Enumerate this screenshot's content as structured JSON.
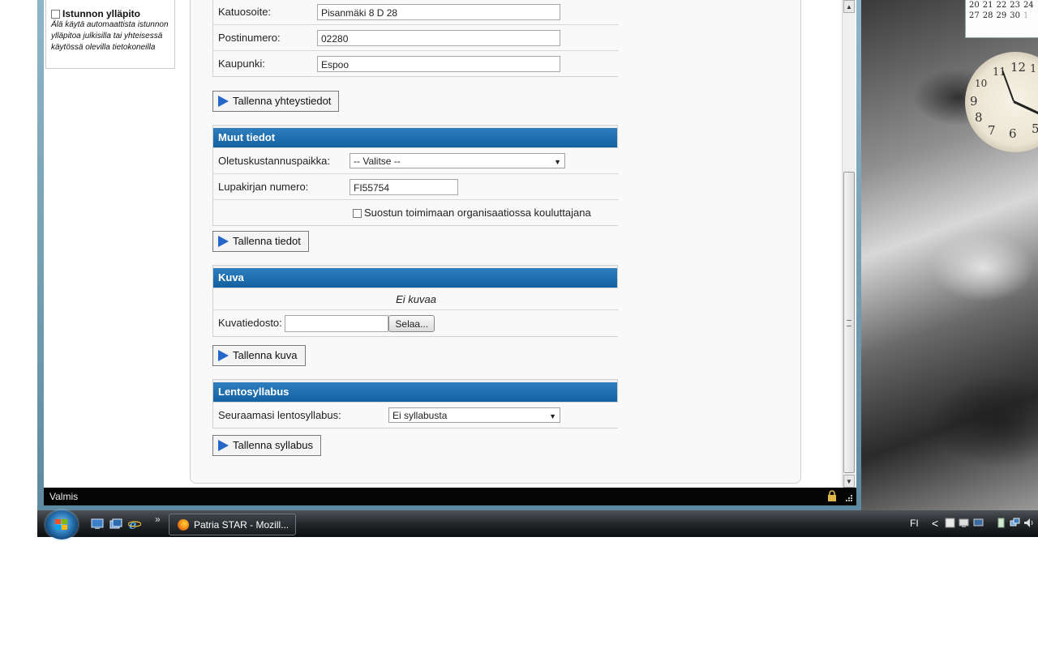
{
  "left_panel": {
    "persist_label": "Istunnon ylläpito",
    "persist_desc": "Älä käytä automaattista istunnon ylläpitoa julkisilla tai yhteisessä käytössä olevilla tietokoneilla"
  },
  "contact": {
    "rows": [
      {
        "label": "Katuosoite:",
        "value": "Pisanmäki 8 D 28"
      },
      {
        "label": "Postinumero:",
        "value": "02280"
      },
      {
        "label": "Kaupunki:",
        "value": "Espoo"
      }
    ],
    "save_label": "Tallenna yhteystiedot"
  },
  "other": {
    "title": "Muut tiedot",
    "cost_center_label": "Oletuskustannuspaikka:",
    "cost_center_value": "-- Valitse --",
    "license_label": "Lupakirjan numero:",
    "license_value": "FI55754",
    "trainer_label": "Suostun toimimaan organisaatiossa kouluttajana",
    "save_label": "Tallenna tiedot"
  },
  "image": {
    "title": "Kuva",
    "no_image": "Ei kuvaa",
    "file_label": "Kuvatiedosto:",
    "browse_label": "Selaa...",
    "save_label": "Tallenna kuva"
  },
  "syllabus": {
    "title": "Lentosyllabus",
    "label": "Seuraamasi lentosyllabus:",
    "value": "Ei syllabusta",
    "save_label": "Tallenna syllabus"
  },
  "status": {
    "text": "Valmis"
  },
  "taskbar": {
    "window_title": "Patria STAR - Mozill...",
    "language": "FI",
    "chevron": "»",
    "tray_chevron": "<"
  },
  "calendar": {
    "rows": [
      [
        "20",
        "21",
        "22",
        "23",
        "24"
      ],
      [
        "27",
        "28",
        "29",
        "30",
        "1"
      ]
    ]
  },
  "clock": {
    "numerals": [
      "12",
      "11",
      "10",
      "9",
      "8",
      "7",
      "6",
      "5",
      "1"
    ]
  },
  "colors": {
    "section_header": "#1a6aad",
    "accent_play": "#2466c9"
  }
}
